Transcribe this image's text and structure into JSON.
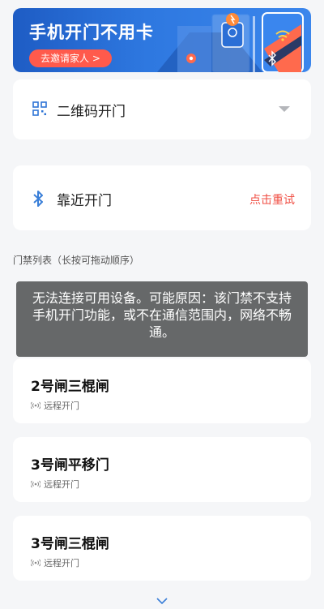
{
  "banner": {
    "title": "手机开门不用卡",
    "cta_label": "去邀请家人 >"
  },
  "qr_open": {
    "label": "二维码开门",
    "icon": "qr-code-icon"
  },
  "bluetooth_open": {
    "label": "靠近开门",
    "retry_label": "点击重试",
    "icon": "bluetooth-icon"
  },
  "section_title": "门禁列表（长按可拖动顺序）",
  "doors": [
    {
      "name": "2号闸三棍闸",
      "mode": "远程开门"
    },
    {
      "name": "3号闸平移门",
      "mode": "远程开门"
    },
    {
      "name": "3号闸三棍闸",
      "mode": "远程开门"
    }
  ],
  "toast": {
    "message": "无法连接可用设备。可能原因：该门禁不支持手机开门功能，或不在通信范围内，网络不畅通。"
  },
  "colors": {
    "accent_red": "#f04f44",
    "banner_blue": "#2e78e0",
    "bluetooth_blue": "#3a7fd8"
  }
}
